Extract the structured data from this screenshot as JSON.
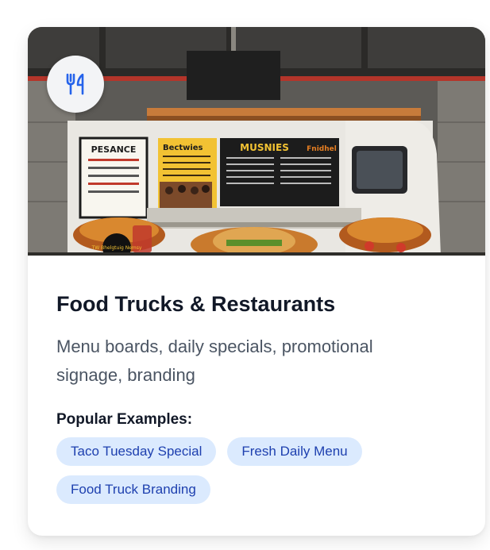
{
  "card": {
    "title": "Food Trucks & Restaurants",
    "description": "Menu boards, daily specials, promotional signage, branding",
    "examples_label": "Popular Examples:",
    "examples": [
      "Taco Tuesday Special",
      "Fresh Daily Menu",
      "Food Truck Branding"
    ],
    "badge_icon": "utensils-icon",
    "hero_image": {
      "subject": "food-truck-photo",
      "menu_headings": [
        "PESANCE",
        "Bectwies",
        "MUSNIES",
        "Fnidhel"
      ],
      "sticker_text": "TW Bhelgtuig Nemsy"
    }
  },
  "colors": {
    "title": "#111827",
    "description": "#4b5563",
    "tag_bg": "#dbeafe",
    "tag_text": "#1e40af",
    "icon_blue": "#2563eb"
  }
}
